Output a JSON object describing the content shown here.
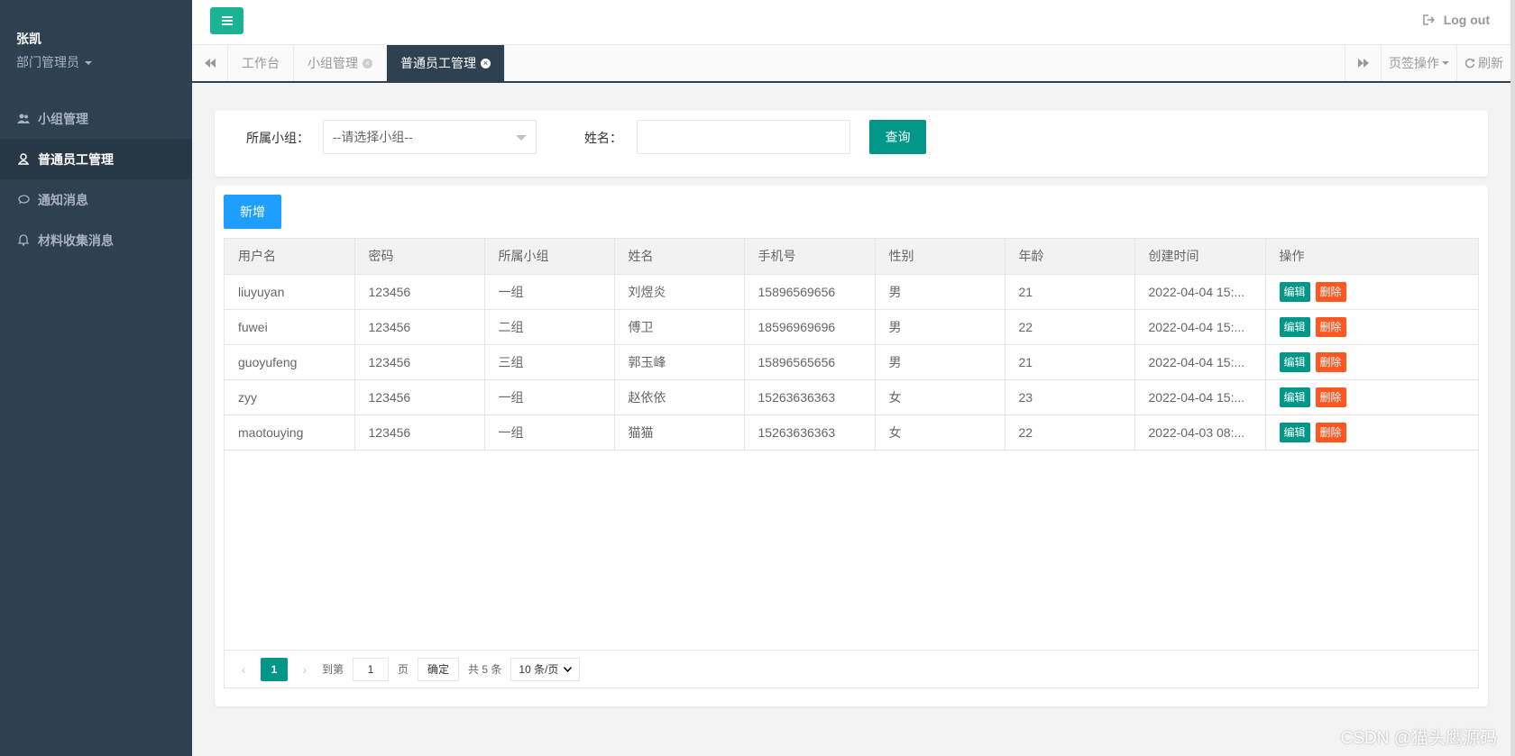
{
  "user": {
    "name": "张凯",
    "role": "部门管理员"
  },
  "nav": [
    {
      "label": "小组管理",
      "icon": "users-icon"
    },
    {
      "label": "普通员工管理",
      "icon": "user-icon",
      "active": true
    },
    {
      "label": "通知消息",
      "icon": "comment-icon"
    },
    {
      "label": "材料收集消息",
      "icon": "bell-icon"
    }
  ],
  "topbar": {
    "logout_label": "Log out"
  },
  "tabs": [
    {
      "label": "工作台",
      "closable": false
    },
    {
      "label": "小组管理",
      "closable": true
    },
    {
      "label": "普通员工管理",
      "closable": true,
      "active": true
    }
  ],
  "tab_actions": {
    "page_ops": "页签操作",
    "refresh": "刷新"
  },
  "search": {
    "group_label": "所属小组：",
    "group_placeholder": "--请选择小组--",
    "name_label": "姓名：",
    "name_value": "",
    "query_button": "查询"
  },
  "add_button": "新增",
  "table": {
    "columns": [
      "用户名",
      "密码",
      "所属小组",
      "姓名",
      "手机号",
      "性别",
      "年龄",
      "创建时间",
      "操作"
    ],
    "rows": [
      [
        "liuyuyan",
        "123456",
        "一组",
        "刘煜炎",
        "15896569656",
        "男",
        "21",
        "2022-04-04 15:..."
      ],
      [
        "fuwei",
        "123456",
        "二组",
        "傅卫",
        "18596969696",
        "男",
        "22",
        "2022-04-04 15:..."
      ],
      [
        "guoyufeng",
        "123456",
        "三组",
        "郭玉峰",
        "15896565656",
        "男",
        "21",
        "2022-04-04 15:..."
      ],
      [
        "zyy",
        "123456",
        "一组",
        "赵依依",
        "15263636363",
        "女",
        "23",
        "2022-04-04 15:..."
      ],
      [
        "maotouying",
        "123456",
        "一组",
        "猫猫",
        "15263636363",
        "女",
        "22",
        "2022-04-03 08:..."
      ]
    ],
    "edit_label": "编辑",
    "delete_label": "删除"
  },
  "pager": {
    "current_page": "1",
    "goto_label": "到第",
    "goto_value": "1",
    "page_unit": "页",
    "confirm": "确定",
    "total": "共 5 条",
    "page_size": "10 条/页"
  },
  "watermark": "CSDN @猫头鹰源码",
  "colors": {
    "sidebar": "#2f4050",
    "primary": "#009688",
    "accent": "#1ab394",
    "blue": "#1e9fff",
    "danger": "#ff5722"
  }
}
